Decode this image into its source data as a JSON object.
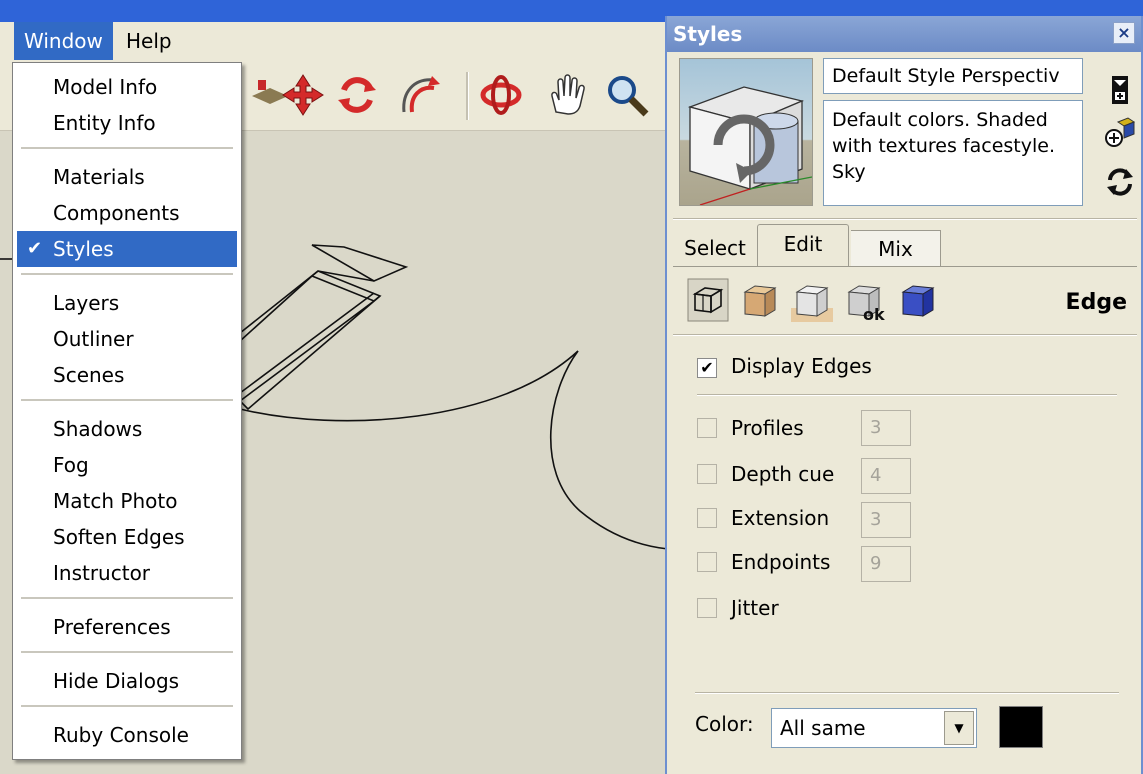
{
  "app": {
    "title_fragment": ""
  },
  "menubar": {
    "window": "Window",
    "help": "Help"
  },
  "window_menu": {
    "items": [
      "Model Info",
      "Entity Info",
      "Materials",
      "Components",
      "Styles",
      "Layers",
      "Outliner",
      "Scenes",
      "Shadows",
      "Fog",
      "Match Photo",
      "Soften Edges",
      "Instructor",
      "Preferences",
      "Hide Dialogs",
      "Ruby Console"
    ],
    "checked_item": "Styles"
  },
  "toolbar": {
    "icons": [
      "pushpull-icon",
      "move-icon",
      "rotate-icon",
      "followme-icon",
      "orbit-icon",
      "pan-icon",
      "zoom-icon"
    ]
  },
  "styles_panel": {
    "title": "Styles",
    "close": "×",
    "style_name": "Default Style Perspectiv",
    "style_description": "Default colors. Shaded with textures facestyle. Sky",
    "tabs": {
      "select": "Select",
      "edit": "Edit",
      "mix": "Mix",
      "active": "Edit"
    },
    "edit_section_title": "Edge",
    "display_edges": {
      "label": "Display Edges",
      "checked": true
    },
    "options": [
      {
        "label": "Profiles",
        "checked": false,
        "value": "3"
      },
      {
        "label": "Depth cue",
        "checked": false,
        "value": "4"
      },
      {
        "label": "Extension",
        "checked": false,
        "value": "3"
      },
      {
        "label": "Endpoints",
        "checked": false,
        "value": "9"
      },
      {
        "label": "Jitter",
        "checked": false
      }
    ],
    "color": {
      "label": "Color:",
      "value": "All same",
      "swatch": "#000000"
    }
  },
  "colors": {
    "accent": "#316ac5",
    "titlebar": "#2f64d8",
    "panel_bg": "#ece9d8",
    "canvas_bg": "#dad8c9"
  }
}
